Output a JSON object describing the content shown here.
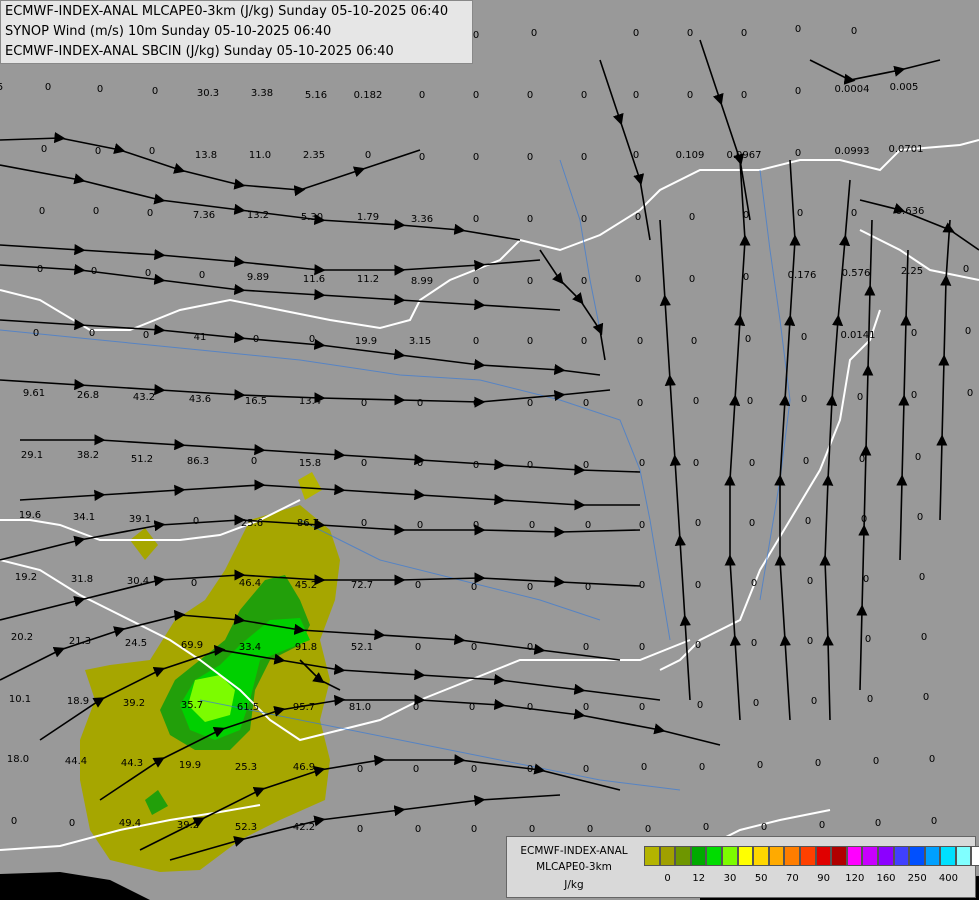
{
  "header": {
    "line1": "ECMWF-INDEX-ANAL MLCAPE0-3km (J/kg) Sunday 05-10-2025 06:40",
    "line2": "SYNOP Wind (m/s) 10m Sunday 05-10-2025 06:40",
    "line3": "ECMWF-INDEX-ANAL SBCIN (J/kg) Sunday 05-10-2025 06:40"
  },
  "legend": {
    "line1": "ECMWF-INDEX-ANAL",
    "line2": "MLCAPE0-3km",
    "line3": "J/kg",
    "colors": [
      "#b4b400",
      "#a0a000",
      "#6e9600",
      "#00aa00",
      "#00dc00",
      "#7cfc00",
      "#ffff00",
      "#ffd700",
      "#ffaa00",
      "#ff7d00",
      "#ff4000",
      "#e00000",
      "#b00000",
      "#ff00ff",
      "#c800ff",
      "#8c00ff",
      "#4040ff",
      "#0050ff",
      "#00a0ff",
      "#00e0ff",
      "#80ffff",
      "#ffffff"
    ],
    "ticks": [
      {
        "label": "0",
        "idx": 1
      },
      {
        "label": "12",
        "idx": 3
      },
      {
        "label": "30",
        "idx": 5
      },
      {
        "label": "50",
        "idx": 7
      },
      {
        "label": "70",
        "idx": 9
      },
      {
        "label": "90",
        "idx": 11
      },
      {
        "label": "120",
        "idx": 13
      },
      {
        "label": "160",
        "idx": 15
      },
      {
        "label": "250",
        "idx": 17
      },
      {
        "label": "400",
        "idx": 19
      }
    ]
  },
  "cin_labels": [
    [
      "5",
      0,
      90
    ],
    [
      "0",
      48,
      90
    ],
    [
      "0",
      100,
      92
    ],
    [
      "0",
      155,
      94
    ],
    [
      "30.3",
      208,
      96
    ],
    [
      "3.38",
      262,
      96
    ],
    [
      "5.16",
      316,
      98
    ],
    [
      "0.182",
      368,
      98
    ],
    [
      "0",
      422,
      98
    ],
    [
      "0",
      476,
      98
    ],
    [
      "0",
      530,
      98
    ],
    [
      "0",
      584,
      98
    ],
    [
      "0",
      636,
      98
    ],
    [
      "0",
      690,
      98
    ],
    [
      "0",
      744,
      98
    ],
    [
      "0",
      798,
      94
    ],
    [
      "0.0004",
      852,
      92
    ],
    [
      "0.005",
      904,
      90
    ],
    [
      "0",
      0,
      38
    ],
    [
      "0",
      534,
      36
    ],
    [
      "0",
      636,
      36
    ],
    [
      "0",
      690,
      36
    ],
    [
      "0",
      744,
      36
    ],
    [
      "0",
      798,
      32
    ],
    [
      "0",
      854,
      34
    ],
    [
      "0",
      422,
      36
    ],
    [
      "0",
      476,
      38
    ],
    [
      "0",
      366,
      36
    ],
    [
      "0",
      44,
      152
    ],
    [
      "0",
      98,
      154
    ],
    [
      "0",
      152,
      154
    ],
    [
      "13.8",
      206,
      158
    ],
    [
      "11.0",
      260,
      158
    ],
    [
      "2.35",
      314,
      158
    ],
    [
      "0",
      368,
      158
    ],
    [
      "0",
      422,
      160
    ],
    [
      "0",
      476,
      160
    ],
    [
      "0",
      530,
      160
    ],
    [
      "0",
      584,
      160
    ],
    [
      "0",
      636,
      158
    ],
    [
      "0.109",
      690,
      158
    ],
    [
      "0.0967",
      744,
      158
    ],
    [
      "0",
      798,
      156
    ],
    [
      "0.0993",
      852,
      154
    ],
    [
      "0.0701",
      906,
      152
    ],
    [
      "0",
      42,
      214
    ],
    [
      "0",
      96,
      214
    ],
    [
      "0",
      150,
      216
    ],
    [
      "7.36",
      204,
      218
    ],
    [
      "13.2",
      258,
      218
    ],
    [
      "5.30",
      312,
      220
    ],
    [
      "1.79",
      368,
      220
    ],
    [
      "3.36",
      422,
      222
    ],
    [
      "0",
      476,
      222
    ],
    [
      "0",
      530,
      222
    ],
    [
      "0",
      584,
      222
    ],
    [
      "0",
      638,
      220
    ],
    [
      "0",
      692,
      220
    ],
    [
      "0",
      746,
      218
    ],
    [
      "0",
      800,
      216
    ],
    [
      "0",
      854,
      216
    ],
    [
      "0.636",
      910,
      214
    ],
    [
      "0",
      40,
      272
    ],
    [
      "0",
      94,
      274
    ],
    [
      "0",
      148,
      276
    ],
    [
      "0",
      202,
      278
    ],
    [
      "9.89",
      258,
      280
    ],
    [
      "11.6",
      314,
      282
    ],
    [
      "11.2",
      368,
      282
    ],
    [
      "8.99",
      422,
      284
    ],
    [
      "0",
      476,
      284
    ],
    [
      "0",
      530,
      284
    ],
    [
      "0",
      584,
      284
    ],
    [
      "0",
      638,
      282
    ],
    [
      "0",
      692,
      282
    ],
    [
      "0",
      746,
      280
    ],
    [
      "0.176",
      802,
      278
    ],
    [
      "0.576",
      856,
      276
    ],
    [
      "2.25",
      912,
      274
    ],
    [
      "0",
      966,
      272
    ],
    [
      "0",
      36,
      336
    ],
    [
      "0",
      92,
      336
    ],
    [
      "0",
      146,
      338
    ],
    [
      "41",
      200,
      340
    ],
    [
      "0",
      256,
      342
    ],
    [
      "0",
      312,
      342
    ],
    [
      "19.9",
      366,
      344
    ],
    [
      "3.15",
      420,
      344
    ],
    [
      "0",
      476,
      344
    ],
    [
      "0",
      530,
      344
    ],
    [
      "0",
      584,
      344
    ],
    [
      "0",
      640,
      344
    ],
    [
      "0",
      694,
      344
    ],
    [
      "0",
      748,
      342
    ],
    [
      "0",
      804,
      340
    ],
    [
      "0.0141",
      858,
      338
    ],
    [
      "0",
      914,
      336
    ],
    [
      "0",
      968,
      334
    ],
    [
      "9.61",
      34,
      396
    ],
    [
      "26.8",
      88,
      398
    ],
    [
      "43.2",
      144,
      400
    ],
    [
      "43.6",
      200,
      402
    ],
    [
      "16.5",
      256,
      404
    ],
    [
      "13.4",
      310,
      404
    ],
    [
      "0",
      364,
      406
    ],
    [
      "0",
      420,
      406
    ],
    [
      "0",
      476,
      406
    ],
    [
      "0",
      530,
      406
    ],
    [
      "0",
      586,
      406
    ],
    [
      "0",
      640,
      406
    ],
    [
      "0",
      696,
      404
    ],
    [
      "0",
      750,
      404
    ],
    [
      "0",
      804,
      402
    ],
    [
      "0",
      860,
      400
    ],
    [
      "0",
      914,
      398
    ],
    [
      "0",
      970,
      396
    ],
    [
      "29.1",
      32,
      458
    ],
    [
      "38.2",
      88,
      458
    ],
    [
      "51.2",
      142,
      462
    ],
    [
      "86.3",
      198,
      464
    ],
    [
      "0",
      254,
      464
    ],
    [
      "15.8",
      310,
      466
    ],
    [
      "0",
      364,
      466
    ],
    [
      "0",
      420,
      466
    ],
    [
      "0",
      476,
      468
    ],
    [
      "0",
      530,
      468
    ],
    [
      "0",
      586,
      468
    ],
    [
      "0",
      642,
      466
    ],
    [
      "0",
      696,
      466
    ],
    [
      "0",
      752,
      466
    ],
    [
      "0",
      806,
      464
    ],
    [
      "0",
      862,
      462
    ],
    [
      "0",
      918,
      460
    ],
    [
      "19.6",
      30,
      518
    ],
    [
      "34.1",
      84,
      520
    ],
    [
      "39.1",
      140,
      522
    ],
    [
      "0",
      196,
      524
    ],
    [
      "25.6",
      252,
      526
    ],
    [
      "86.7",
      308,
      526
    ],
    [
      "0",
      364,
      526
    ],
    [
      "0",
      420,
      528
    ],
    [
      "0",
      476,
      528
    ],
    [
      "0",
      532,
      528
    ],
    [
      "0",
      588,
      528
    ],
    [
      "0",
      642,
      528
    ],
    [
      "0",
      698,
      526
    ],
    [
      "0",
      752,
      526
    ],
    [
      "0",
      808,
      524
    ],
    [
      "0",
      864,
      522
    ],
    [
      "0",
      920,
      520
    ],
    [
      "19.2",
      26,
      580
    ],
    [
      "31.8",
      82,
      582
    ],
    [
      "30.4",
      138,
      584
    ],
    [
      "0",
      194,
      586
    ],
    [
      "46.4",
      250,
      586
    ],
    [
      "45.2",
      306,
      588
    ],
    [
      "72.7",
      362,
      588
    ],
    [
      "0",
      418,
      588
    ],
    [
      "0",
      474,
      590
    ],
    [
      "0",
      530,
      590
    ],
    [
      "0",
      588,
      590
    ],
    [
      "0",
      642,
      588
    ],
    [
      "0",
      698,
      588
    ],
    [
      "0",
      754,
      586
    ],
    [
      "0",
      810,
      584
    ],
    [
      "0",
      866,
      582
    ],
    [
      "0",
      922,
      580
    ],
    [
      "20.2",
      22,
      640
    ],
    [
      "21.3",
      80,
      644
    ],
    [
      "24.5",
      136,
      646
    ],
    [
      "69.9",
      192,
      648
    ],
    [
      "33.4",
      250,
      650
    ],
    [
      "91.8",
      306,
      650
    ],
    [
      "52.1",
      362,
      650
    ],
    [
      "0",
      418,
      650
    ],
    [
      "0",
      474,
      650
    ],
    [
      "0",
      530,
      650
    ],
    [
      "0",
      586,
      650
    ],
    [
      "0",
      642,
      650
    ],
    [
      "0",
      698,
      648
    ],
    [
      "0",
      754,
      646
    ],
    [
      "0",
      810,
      644
    ],
    [
      "0",
      868,
      642
    ],
    [
      "0",
      924,
      640
    ],
    [
      "10.1",
      20,
      702
    ],
    [
      "18.9",
      78,
      704
    ],
    [
      "39.2",
      134,
      706
    ],
    [
      "35.7",
      192,
      708
    ],
    [
      "61.5",
      248,
      710
    ],
    [
      "95.7",
      304,
      710
    ],
    [
      "81.0",
      360,
      710
    ],
    [
      "0",
      416,
      710
    ],
    [
      "0",
      472,
      710
    ],
    [
      "0",
      530,
      710
    ],
    [
      "0",
      586,
      710
    ],
    [
      "0",
      642,
      710
    ],
    [
      "0",
      700,
      708
    ],
    [
      "0",
      756,
      706
    ],
    [
      "0",
      814,
      704
    ],
    [
      "0",
      870,
      702
    ],
    [
      "0",
      926,
      700
    ],
    [
      "18.0",
      18,
      762
    ],
    [
      "44.4",
      76,
      764
    ],
    [
      "44.3",
      132,
      766
    ],
    [
      "19.9",
      190,
      768
    ],
    [
      "25.3",
      246,
      770
    ],
    [
      "46.9",
      304,
      770
    ],
    [
      "0",
      360,
      772
    ],
    [
      "0",
      416,
      772
    ],
    [
      "0",
      474,
      772
    ],
    [
      "0",
      530,
      772
    ],
    [
      "0",
      586,
      772
    ],
    [
      "0",
      644,
      770
    ],
    [
      "0",
      702,
      770
    ],
    [
      "0",
      760,
      768
    ],
    [
      "0",
      818,
      766
    ],
    [
      "0",
      876,
      764
    ],
    [
      "0",
      932,
      762
    ],
    [
      "0",
      14,
      824
    ],
    [
      "0",
      72,
      826
    ],
    [
      "49.4",
      130,
      826
    ],
    [
      "39.2",
      188,
      828
    ],
    [
      "52.3",
      246,
      830
    ],
    [
      "42.2",
      304,
      830
    ],
    [
      "0",
      360,
      832
    ],
    [
      "0",
      418,
      832
    ],
    [
      "0",
      474,
      832
    ],
    [
      "0",
      532,
      832
    ],
    [
      "0",
      590,
      832
    ],
    [
      "0",
      648,
      832
    ],
    [
      "0",
      706,
      830
    ],
    [
      "0",
      764,
      830
    ],
    [
      "0",
      822,
      828
    ],
    [
      "0",
      878,
      826
    ],
    [
      "0",
      934,
      824
    ]
  ]
}
